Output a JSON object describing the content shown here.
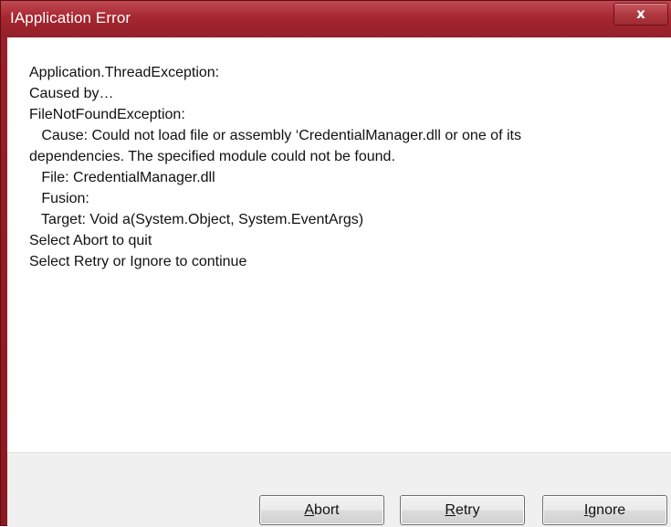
{
  "window": {
    "title": "IApplication Error",
    "close_glyph": "x",
    "close_icon": "close-icon"
  },
  "message": {
    "lines": [
      "Application.ThreadException:",
      "",
      "Caused by…",
      "",
      "FileNotFoundException:",
      "   Cause: Could not load file or assembly ‘CredentialManager.dll or one of its",
      "dependencies. The specified module could not be found.",
      "   File: CredentialManager.dll",
      "   Fusion:",
      "   Target: Void a(System.Object, System.EventArgs)",
      "",
      "",
      "Select Abort to quit",
      "Select Retry or Ignore to continue"
    ]
  },
  "buttons": {
    "abort": {
      "accel": "A",
      "rest": "bort"
    },
    "retry": {
      "accel": "R",
      "rest": "etry"
    },
    "ignore": {
      "accel": "I",
      "rest": "gnore"
    }
  },
  "colors": {
    "titlebar": "#a6262f",
    "client": "#ffffff",
    "footer": "#f0f0f0"
  }
}
